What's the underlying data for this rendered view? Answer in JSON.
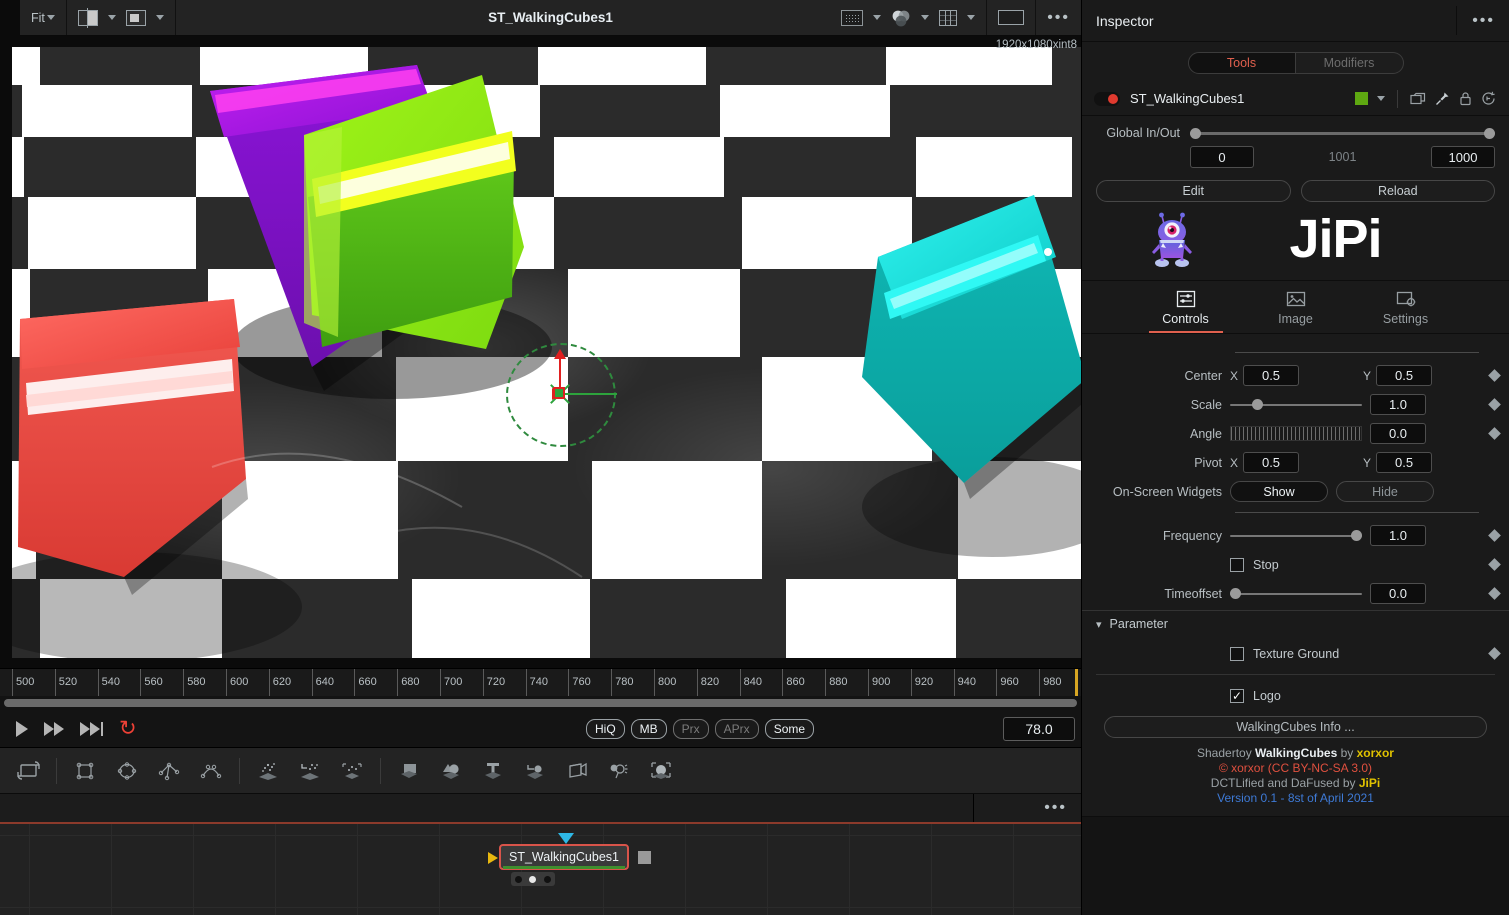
{
  "viewer_toolbar": {
    "fit_label": "Fit",
    "split_icon": "split-view-icon",
    "pip_icon": "picture-in-picture-icon",
    "roi_icon": "region-of-interest-icon",
    "color_icon": "color-wheels-icon",
    "grid_icon": "grid-icon",
    "frame_icon": "frame-icon",
    "more_icon": "more-options-icon",
    "title": "ST_WalkingCubes1",
    "resolution": "1920x1080xint8"
  },
  "timeline": {
    "ticks": [
      "500",
      "520",
      "540",
      "560",
      "580",
      "600",
      "620",
      "640",
      "660",
      "680",
      "700",
      "720",
      "740",
      "760",
      "780",
      "800",
      "820",
      "840",
      "860",
      "880",
      "900",
      "920",
      "940",
      "960",
      "980"
    ],
    "playhead_frame": "1000",
    "current_time": "78.0",
    "quality_buttons": [
      {
        "label": "HiQ",
        "active": true
      },
      {
        "label": "MB",
        "active": true
      },
      {
        "label": "Prx",
        "active": false
      },
      {
        "label": "APrx",
        "active": false
      },
      {
        "label": "Some",
        "active": true
      }
    ],
    "transport": {
      "play": "play-icon",
      "forward": "fast-forward-icon",
      "end": "skip-to-end-icon",
      "loop": "loop-icon"
    }
  },
  "node_toolbar": {
    "icons": [
      "transform-icon",
      "rectangle-mask-icon",
      "ellipse-mask-icon",
      "polygon-mask-icon",
      "bspline-mask-icon",
      "particle-emitter-icon",
      "particle-spawn-icon",
      "particle-render-icon",
      "image-plane-3d-icon",
      "shape-3d-icon",
      "text-3d-icon",
      "replicate-3d-icon",
      "camera-3d-icon",
      "spotlight-3d-icon",
      "renderer-3d-icon"
    ]
  },
  "flow": {
    "more_icon": "more-options-icon",
    "node": {
      "name": "ST_WalkingCubes1",
      "input_icon": "node-input-arrow",
      "output_icon": "node-output-square",
      "mask_icon": "node-mask-triangle"
    }
  },
  "inspector": {
    "title": "Inspector",
    "more_icon": "more-options-icon",
    "tabs_top": [
      {
        "label": "Tools",
        "active": true
      },
      {
        "label": "Modifiers",
        "active": false
      }
    ],
    "tool": {
      "name": "ST_WalkingCubes1",
      "enable_toggle": "enable-toggle",
      "swatch_color": "#5ea811",
      "chevron_icon": "chevron-down-icon",
      "copy_icon": "duplicate-icon",
      "pin_icon": "pin-icon",
      "lock_icon": "lock-icon",
      "reset_icon": "reset-icon"
    },
    "global_in_out": {
      "label": "Global In/Out",
      "in_value": "0",
      "mid_value": "1001",
      "out_value": "1000"
    },
    "buttons": {
      "edit": "Edit",
      "reload": "Reload"
    },
    "brand": {
      "mascot": "jipi-mascot-icon",
      "text": "JiPi"
    },
    "tabs": [
      {
        "label": "Controls",
        "icon": "sliders-icon",
        "active": true
      },
      {
        "label": "Image",
        "icon": "image-icon",
        "active": false
      },
      {
        "label": "Settings",
        "icon": "settings-icon",
        "active": false
      }
    ],
    "controls": {
      "center": {
        "label": "Center",
        "x_label": "X",
        "x": "0.5",
        "y_label": "Y",
        "y": "0.5"
      },
      "scale": {
        "label": "Scale",
        "value": "1.0",
        "knob_pct": 20
      },
      "angle": {
        "label": "Angle",
        "value": "0.0"
      },
      "pivot": {
        "label": "Pivot",
        "x_label": "X",
        "x": "0.5",
        "y_label": "Y",
        "y": "0.5"
      },
      "onscreen": {
        "label": "On-Screen Widgets",
        "show": "Show",
        "hide": "Hide",
        "active": "Show"
      },
      "frequency": {
        "label": "Frequency",
        "value": "1.0",
        "knob_pct": 96
      },
      "stop": {
        "label": "Stop",
        "checked": false
      },
      "timeoffset": {
        "label": "Timeoffset",
        "value": "0.0",
        "knob_pct": 0
      }
    },
    "parameter_section": {
      "label": "Parameter",
      "arrow_icon": "chevron-down-icon",
      "texture_ground": {
        "label": "Texture Ground",
        "checked": false
      },
      "logo": {
        "label": "Logo",
        "checked": true
      },
      "info_button": "WalkingCubes Info ..."
    },
    "credits": {
      "line1_prefix": "Shadertoy ",
      "line1_bold": "WalkingCubes",
      "line1_mid": " by ",
      "line1_author": "xorxor",
      "line2": "© xorxor (CC BY-NC-SA 3.0)",
      "line3_prefix": "DCTLified and DaFused by ",
      "line3_author": "JiPi",
      "line4": "Version 0.1 - 8st of April 2021"
    }
  }
}
